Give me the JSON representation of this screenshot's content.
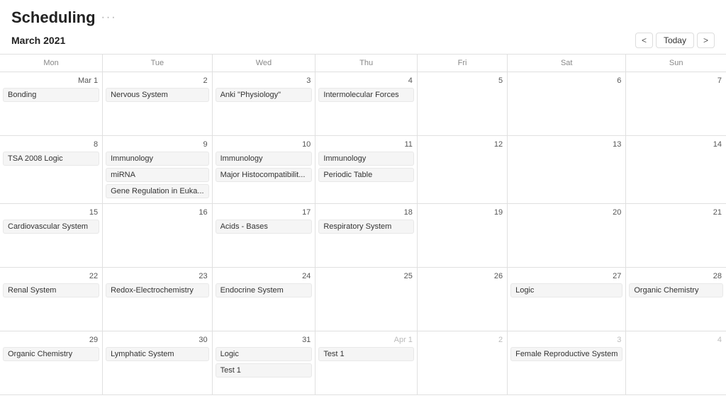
{
  "header": {
    "title": "Scheduling",
    "menu_dots": "···",
    "month_year": "March 2021"
  },
  "nav": {
    "prev_label": "<",
    "next_label": ">",
    "today_label": "Today"
  },
  "day_headers": [
    "Mon",
    "Tue",
    "Wed",
    "Thu",
    "Fri",
    "Sat",
    "Sun"
  ],
  "weeks": [
    {
      "days": [
        {
          "num": "Mar 1",
          "other": false,
          "events": [
            "Bonding"
          ]
        },
        {
          "num": "2",
          "other": false,
          "events": [
            "Nervous System"
          ]
        },
        {
          "num": "3",
          "other": false,
          "events": [
            "Anki \"Physiology\""
          ]
        },
        {
          "num": "4",
          "other": false,
          "events": [
            "Intermolecular Forces"
          ]
        },
        {
          "num": "5",
          "other": false,
          "events": []
        },
        {
          "num": "6",
          "other": false,
          "events": []
        },
        {
          "num": "7",
          "other": false,
          "events": []
        }
      ]
    },
    {
      "days": [
        {
          "num": "8",
          "other": false,
          "events": [
            "TSA 2008 Logic"
          ]
        },
        {
          "num": "9",
          "other": false,
          "events": [
            "Immunology",
            "miRNA",
            "Gene Regulation in Euka..."
          ]
        },
        {
          "num": "10",
          "other": false,
          "events": [
            "Immunology",
            "Major Histocompatibilit..."
          ]
        },
        {
          "num": "11",
          "other": false,
          "events": [
            "Immunology",
            "Periodic Table"
          ]
        },
        {
          "num": "12",
          "other": false,
          "events": []
        },
        {
          "num": "13",
          "other": false,
          "events": []
        },
        {
          "num": "14",
          "other": false,
          "events": []
        }
      ]
    },
    {
      "days": [
        {
          "num": "15",
          "other": false,
          "events": [
            "Cardiovascular System"
          ]
        },
        {
          "num": "16",
          "other": false,
          "events": []
        },
        {
          "num": "17",
          "other": false,
          "events": [
            "Acids - Bases"
          ]
        },
        {
          "num": "18",
          "other": false,
          "events": [
            "Respiratory System"
          ]
        },
        {
          "num": "19",
          "other": false,
          "events": []
        },
        {
          "num": "20",
          "other": false,
          "events": []
        },
        {
          "num": "21",
          "other": false,
          "events": []
        }
      ]
    },
    {
      "days": [
        {
          "num": "22",
          "other": false,
          "events": [
            "Renal System"
          ]
        },
        {
          "num": "23",
          "other": false,
          "events": [
            "Redox-Electrochemistry"
          ]
        },
        {
          "num": "24",
          "other": false,
          "events": [
            "Endocrine System"
          ]
        },
        {
          "num": "25",
          "other": false,
          "events": []
        },
        {
          "num": "26",
          "other": false,
          "events": []
        },
        {
          "num": "27",
          "other": false,
          "events": [
            "Logic"
          ]
        },
        {
          "num": "28",
          "other": false,
          "events": [
            "Organic Chemistry"
          ]
        }
      ]
    },
    {
      "days": [
        {
          "num": "29",
          "other": false,
          "events": [
            "Organic Chemistry"
          ]
        },
        {
          "num": "30",
          "other": false,
          "events": [
            "Lymphatic System"
          ]
        },
        {
          "num": "31",
          "other": false,
          "events": [
            "Logic",
            "Test 1"
          ]
        },
        {
          "num": "Apr 1",
          "other": true,
          "events": [
            "Test 1"
          ]
        },
        {
          "num": "2",
          "other": true,
          "events": []
        },
        {
          "num": "3",
          "other": true,
          "events": [
            "Female Reproductive System"
          ]
        },
        {
          "num": "4",
          "other": true,
          "events": []
        }
      ]
    }
  ]
}
